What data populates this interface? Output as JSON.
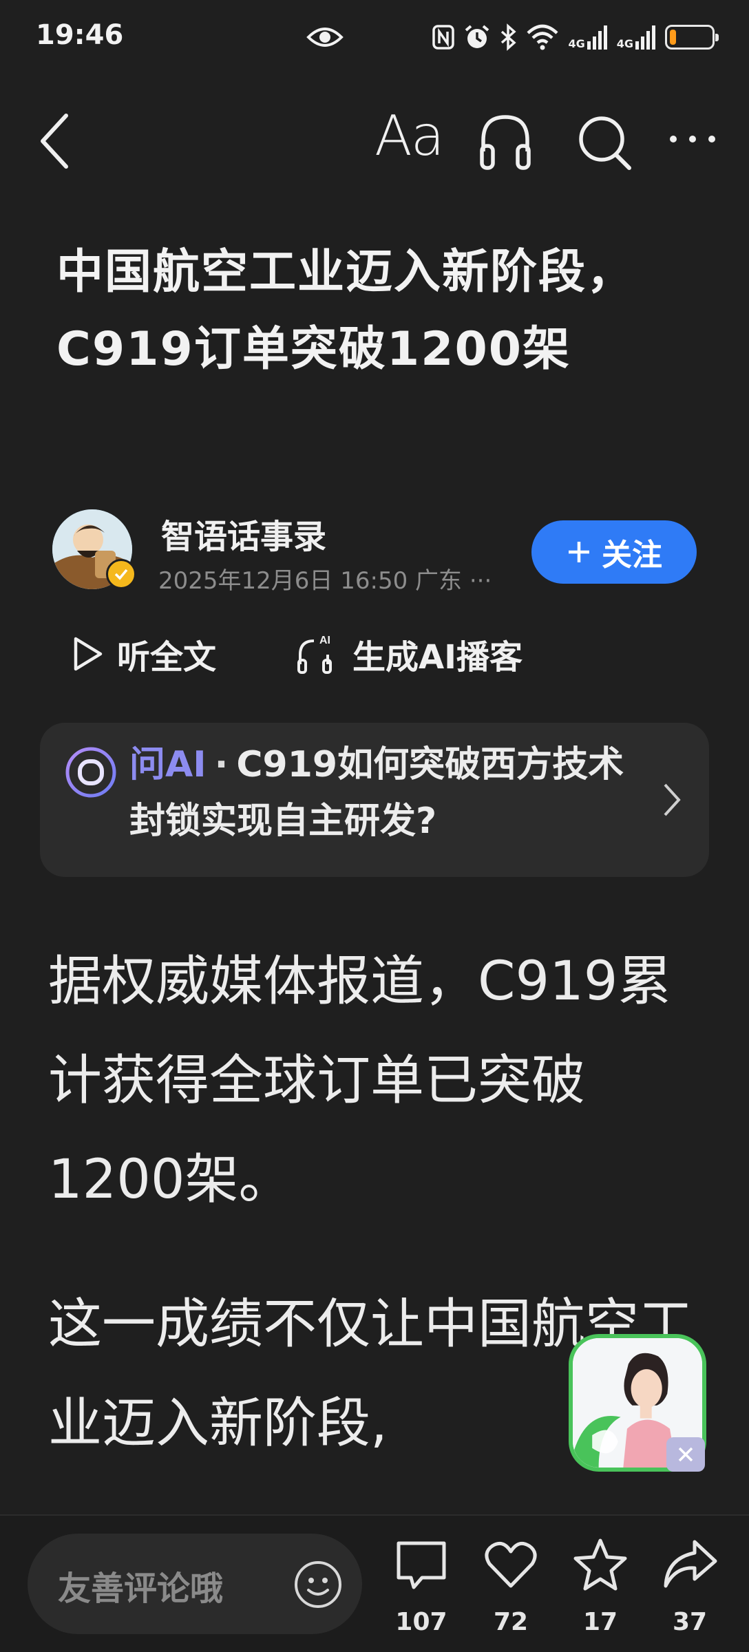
{
  "status_bar": {
    "time": "19:46",
    "signal1_label": "4G",
    "signal2_label": "4G",
    "wifi_label": "6",
    "battery_level": 0.15,
    "battery_color": "#ff9b1a"
  },
  "nav": {
    "font_button_label": "Aa",
    "icons": [
      "back-icon",
      "font-size-icon",
      "headphones-icon",
      "search-icon",
      "more-icon"
    ]
  },
  "article": {
    "title": "中国航空工业迈入新阶段，C919订单突破1200架",
    "author_name": "智语话事录",
    "meta": "2025年12月6日 16:50 广东 ···",
    "follow_label": "关注",
    "listen_label": "听全文",
    "generate_podcast_label": "生成AI播客",
    "ask_ai": {
      "brand": "问AI",
      "question": "C919如何突破西方技术封锁实现自主研发?"
    },
    "paragraphs": [
      "据权威媒体报道，C919累计获得全球订单已突破1200架。",
      "这一成绩不仅让中国航空工业迈入新阶段,"
    ]
  },
  "bottom_bar": {
    "comment_placeholder": "友善评论哦",
    "comments_count": "107",
    "likes_count": "72",
    "favorites_count": "17",
    "shares_count": "37"
  },
  "colors": {
    "background": "#1f1f1f",
    "accent_blue": "#2f7bf6",
    "ai_purple": "#8d8cf0",
    "verified_gold": "#f5b81c"
  }
}
